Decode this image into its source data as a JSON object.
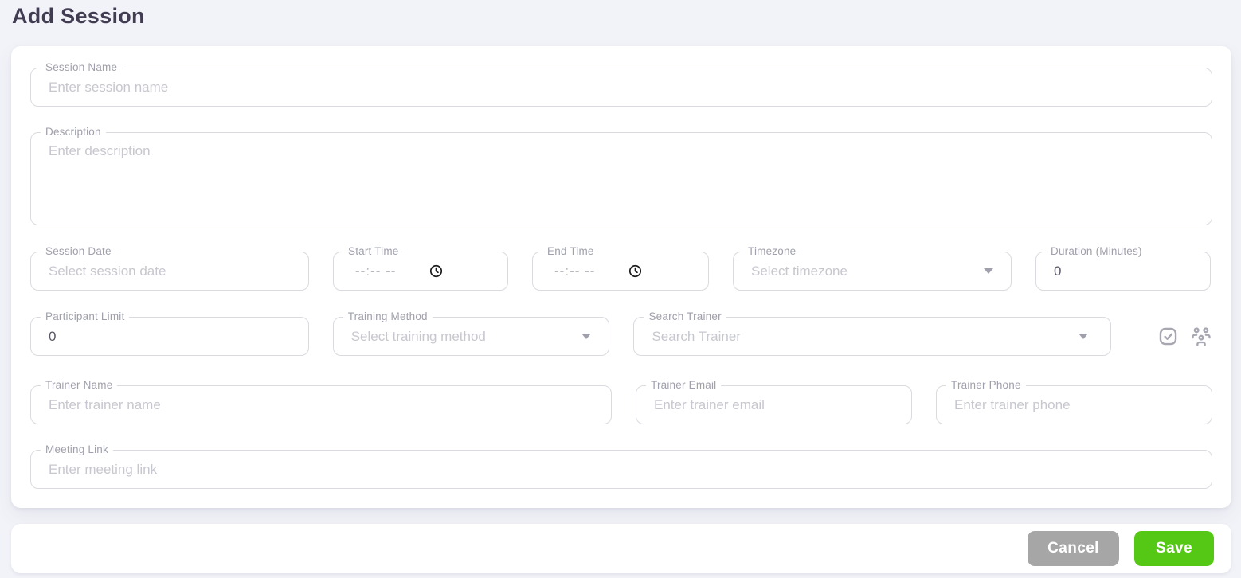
{
  "page": {
    "title": "Add Session"
  },
  "form": {
    "session_name": {
      "label": "Session Name",
      "placeholder": "Enter session name"
    },
    "description": {
      "label": "Description",
      "placeholder": "Enter description"
    },
    "session_date": {
      "label": "Session Date",
      "placeholder": "Select session date"
    },
    "start_time": {
      "label": "Start Time",
      "value": "--:-- --"
    },
    "end_time": {
      "label": "End Time",
      "value": "--:-- --"
    },
    "timezone": {
      "label": "Timezone",
      "placeholder": "Select timezone"
    },
    "duration": {
      "label": "Duration (Minutes)",
      "value": "0"
    },
    "participant_limit": {
      "label": "Participant Limit",
      "value": "0"
    },
    "training_method": {
      "label": "Training Method",
      "placeholder": "Select training method"
    },
    "search_trainer": {
      "label": "Search Trainer",
      "placeholder": "Search Trainer"
    },
    "trainer_name": {
      "label": "Trainer Name",
      "placeholder": "Enter trainer name"
    },
    "trainer_email": {
      "label": "Trainer Email",
      "placeholder": "Enter trainer email"
    },
    "trainer_phone": {
      "label": "Trainer Phone",
      "placeholder": "Enter trainer phone"
    },
    "meeting_link": {
      "label": "Meeting Link",
      "placeholder": "Enter meeting link"
    }
  },
  "icons": {
    "clock": "clock-icon",
    "caret": "chevron-down-icon",
    "check_square": "check-square-icon",
    "users_group": "users-group-icon"
  },
  "actions": {
    "cancel": "Cancel",
    "save": "Save"
  },
  "colors": {
    "page_bg": "#f2f3f8",
    "card_bg": "#ffffff",
    "border": "#dadae0",
    "label": "#9fa0ab",
    "placeholder": "#c7c7cf",
    "title": "#413c51",
    "save_green": "#55c715",
    "cancel_gray": "#a6a6a6"
  }
}
